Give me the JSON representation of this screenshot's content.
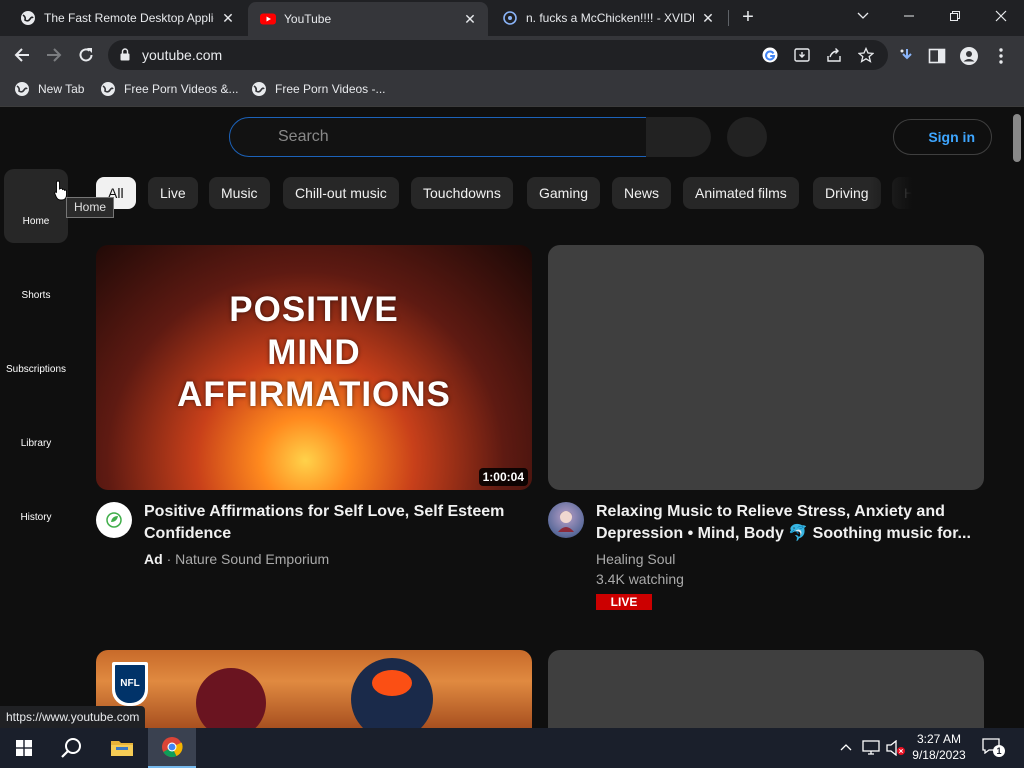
{
  "browser": {
    "tabs": [
      {
        "title": "The Fast Remote Desktop Applic",
        "active": false
      },
      {
        "title": "YouTube",
        "active": true
      },
      {
        "title": "n. fucks a McChicken!!!! - XVIDE",
        "active": false
      }
    ],
    "close_glyph": "✕",
    "new_tab_glyph": "+",
    "url": "youtube.com",
    "bookmarks": [
      {
        "label": "New Tab"
      },
      {
        "label": "Free Porn Videos &..."
      },
      {
        "label": "Free Porn Videos -..."
      }
    ],
    "status_url": "https://www.youtube.com"
  },
  "youtube": {
    "search_placeholder": "Search",
    "sign_in_label": "Sign in",
    "sidebar": [
      {
        "label": "Home",
        "active": true
      },
      {
        "label": "Shorts"
      },
      {
        "label": "Subscriptions"
      },
      {
        "label": "Library"
      },
      {
        "label": "History"
      }
    ],
    "tooltip": "Home",
    "chips": [
      "All",
      "Live",
      "Music",
      "Chill-out music",
      "Touchdowns",
      "Gaming",
      "News",
      "Animated films",
      "Driving",
      "H"
    ],
    "videos": [
      {
        "thumb_lines": [
          "POSITIVE",
          "MIND",
          "AFFIRMATIONS"
        ],
        "duration": "1:00:04",
        "title_line1": "Positive Affirmations for Self Love, Self Esteem",
        "title_line2": "Confidence",
        "ad_label": "Ad",
        "separator": "·",
        "channel": "Nature Sound Emporium"
      },
      {
        "title_line1": "Relaxing Music to Relieve Stress, Anxiety and",
        "title_line2": "Depression • Mind, Body 🐬 Soothing music for...",
        "channel": "Healing Soul",
        "views": "3.4K watching",
        "live_badge": "LIVE"
      }
    ],
    "nfl_logo_text": "NFL"
  },
  "taskbar": {
    "time": "3:27 AM",
    "date": "9/18/2023",
    "notification_count": "1"
  },
  "colors": {
    "yt_bg": "#0f0f0f",
    "chip_bg": "#272727",
    "link_blue": "#3ea6ff",
    "live_red": "#cc0000"
  }
}
